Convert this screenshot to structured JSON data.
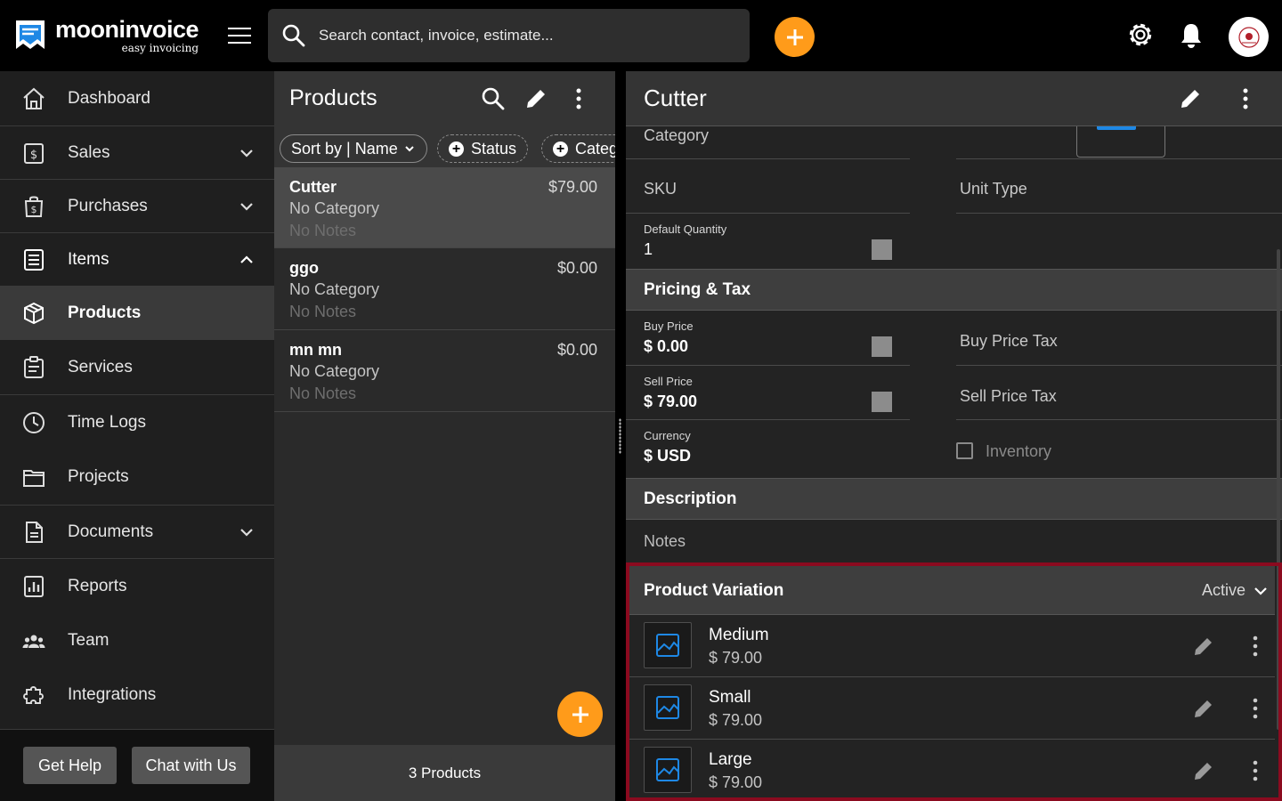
{
  "brand": {
    "name": "mooninvoice",
    "tagline": "easy invoicing"
  },
  "search": {
    "placeholder": "Search contact, invoice, estimate..."
  },
  "sidebar": {
    "items": [
      {
        "label": "Dashboard",
        "icon": "home-icon"
      },
      {
        "label": "Sales",
        "icon": "sales-icon",
        "expandable": true
      },
      {
        "label": "Purchases",
        "icon": "purchases-icon",
        "expandable": true
      },
      {
        "label": "Items",
        "icon": "items-icon",
        "expanded": true
      },
      {
        "label": "Products",
        "icon": "box-icon",
        "active": true
      },
      {
        "label": "Services",
        "icon": "clipboard-icon"
      },
      {
        "label": "Time Logs",
        "icon": "clock-icon"
      },
      {
        "label": "Projects",
        "icon": "folder-icon"
      },
      {
        "label": "Documents",
        "icon": "document-icon",
        "expandable": true
      },
      {
        "label": "Reports",
        "icon": "report-icon"
      },
      {
        "label": "Team",
        "icon": "team-icon"
      },
      {
        "label": "Integrations",
        "icon": "puzzle-icon"
      }
    ],
    "footer": {
      "help_label": "Get Help",
      "chat_label": "Chat with Us"
    }
  },
  "list": {
    "title": "Products",
    "chips": {
      "sort": "Sort by | Name",
      "status": "Status",
      "category": "Categ"
    },
    "rows": [
      {
        "name": "Cutter",
        "price": "$79.00",
        "category": "No Category",
        "notes": "No Notes"
      },
      {
        "name": "ggo",
        "price": "$0.00",
        "category": "No Category",
        "notes": "No Notes"
      },
      {
        "name": "mn mn",
        "price": "$0.00",
        "category": "No Category",
        "notes": "No Notes"
      }
    ],
    "footer": "3 Products"
  },
  "detail": {
    "title": "Cutter",
    "fields": {
      "category_label": "Category",
      "sku_label": "SKU",
      "unit_type_label": "Unit Type",
      "default_qty_label": "Default Quantity",
      "default_qty_value": "1",
      "buy_price_label": "Buy Price",
      "buy_price_value": "$ 0.00",
      "buy_tax_label": "Buy Price Tax",
      "sell_price_label": "Sell Price",
      "sell_price_value": "$ 79.00",
      "sell_tax_label": "Sell Price Tax",
      "currency_label": "Currency",
      "currency_value": "$ USD",
      "inventory_label": "Inventory"
    },
    "sections": {
      "pricing": "Pricing & Tax",
      "description": "Description",
      "notes_label": "Notes"
    },
    "variation": {
      "title": "Product Variation",
      "status": "Active",
      "items": [
        {
          "name": "Medium",
          "price": "$ 79.00"
        },
        {
          "name": "Small",
          "price": "$ 79.00"
        },
        {
          "name": "Large",
          "price": "$ 79.00"
        }
      ]
    }
  },
  "colors": {
    "accent": "#ff9b1a",
    "highlight": "#8b0a1f",
    "link_blue": "#1e88e5"
  }
}
